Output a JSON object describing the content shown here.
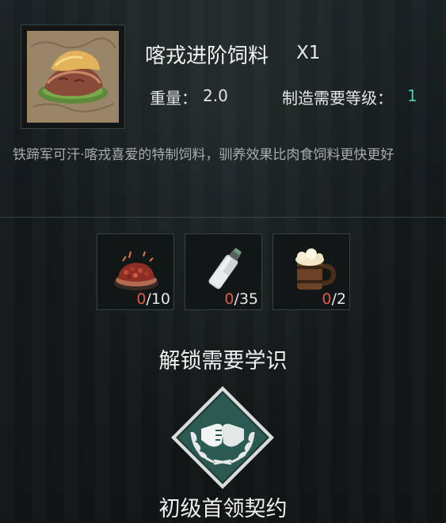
{
  "item": {
    "name": "喀戎进阶饲料",
    "quantity": "X1",
    "weight_label": "重量：",
    "weight_value": "2.0",
    "craft_level_label": "制造需要等级：",
    "craft_level_value": "1",
    "description": "铁蹄军可汗·喀戎喜爱的特制饲料，驯养效果比肉食饲料更快更好"
  },
  "materials": [
    {
      "icon": "minced-meat-icon",
      "have": "0",
      "need": "/10"
    },
    {
      "icon": "salt-bottle-icon",
      "have": "0",
      "need": "/35"
    },
    {
      "icon": "ale-mug-icon",
      "have": "0",
      "need": "/2"
    }
  ],
  "unlock": {
    "title": "解锁需要学识",
    "skill_name": "初级首领契约",
    "skill_icon": "handshake-laurel-icon"
  },
  "colors": {
    "accent": "#4fc7b5",
    "insufficient": "#e05a4a",
    "badge_fill": "#2b5a52"
  }
}
